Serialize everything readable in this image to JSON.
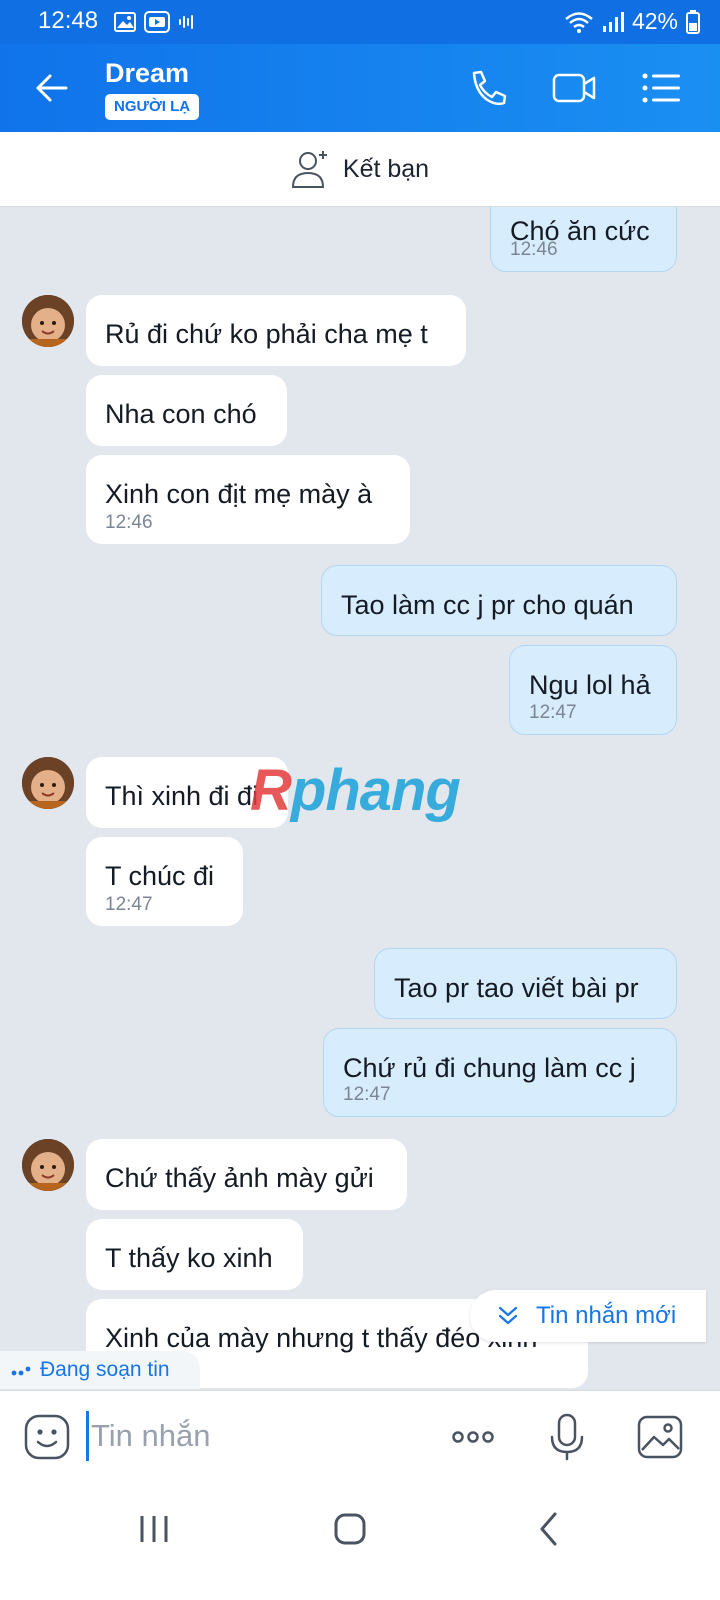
{
  "status_bar": {
    "time": "12:48",
    "battery": "42%"
  },
  "header": {
    "contact_name": "Dream",
    "badge": "NGƯỜI LẠ"
  },
  "add_friend": {
    "label": "Kết bạn"
  },
  "messages": [
    {
      "dir": "out",
      "text": "Chó ăn cức",
      "time": "12:46"
    },
    {
      "dir": "in",
      "text": "Rủ đi chứ ko phải cha mẹ t",
      "time": ""
    },
    {
      "dir": "in",
      "text": "Nha con chó",
      "time": ""
    },
    {
      "dir": "in",
      "text": "Xinh con địt mẹ mày à",
      "time": "12:46"
    },
    {
      "dir": "out",
      "text": "Tao làm cc j pr cho quán",
      "time": ""
    },
    {
      "dir": "out",
      "text": "Ngu lol hả",
      "time": "12:47"
    },
    {
      "dir": "in",
      "text": "Thì xinh đi đi",
      "time": ""
    },
    {
      "dir": "in",
      "text": "T chúc đi",
      "time": "12:47"
    },
    {
      "dir": "out",
      "text": "Tao pr tao viết bài pr",
      "time": ""
    },
    {
      "dir": "out",
      "text": "Chứ rủ đi chung làm cc j",
      "time": "12:47"
    },
    {
      "dir": "in",
      "text": "Chứ thấy ảnh mày gửi",
      "time": ""
    },
    {
      "dir": "in",
      "text": "T thấy ko xinh",
      "time": ""
    },
    {
      "dir": "in",
      "text": "Xinh của mày nhưng t thấy đéo xinh",
      "time": ""
    }
  ],
  "watermark": {
    "first": "R",
    "rest": "phang"
  },
  "new_message_pill": {
    "label": "Tin nhắn mới"
  },
  "typing_indicator": {
    "label": "Đang soạn tin"
  },
  "input": {
    "placeholder": "Tin nhắn"
  },
  "colors": {
    "header_bg": "#1073ea",
    "chat_bg": "#e2e7ed",
    "outgoing_bubble": "#d7ecfc",
    "accent": "#1776e6"
  }
}
